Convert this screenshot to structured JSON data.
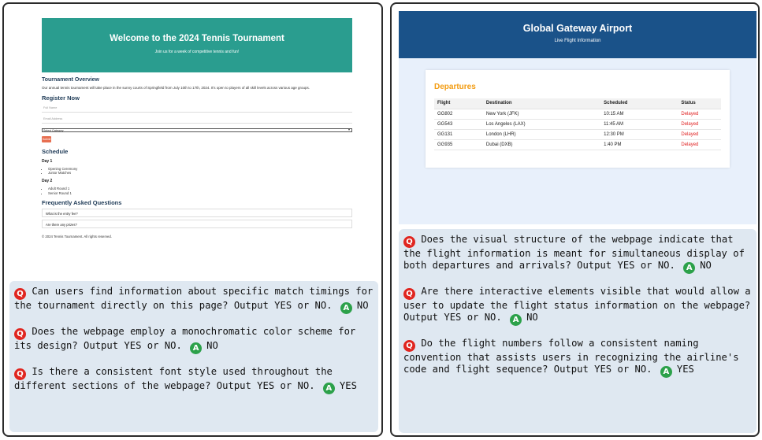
{
  "left": {
    "hero": {
      "title": "Welcome to the 2024 Tennis Tournament",
      "subtitle": "Join us for a week of competitive tennis and fun!"
    },
    "overview": {
      "heading": "Tournament Overview",
      "text": "Our annual tennis tournament will take place in the sunny courts of Springfield from July 10th to 17th, 2024. It's open to players of all skill levels across various age groups."
    },
    "register": {
      "heading": "Register Now",
      "name_placeholder": "Full Name",
      "email_placeholder": "Email Address",
      "category_selected": "Select Category",
      "submit_label": "Submit"
    },
    "schedule": {
      "heading": "Schedule",
      "days": [
        {
          "label": "Day 1",
          "items": [
            "Opening Ceremony",
            "Junior Matches"
          ]
        },
        {
          "label": "Day 2",
          "items": [
            "Adult Round 1",
            "Senior Round 1"
          ]
        }
      ]
    },
    "faq": {
      "heading": "Frequently Asked Questions",
      "items": [
        "What is the entry fee?",
        "Are there any prizes?"
      ]
    },
    "footer": "© 2024 Tennis Tournament. All rights reserved.",
    "qa": [
      {
        "q": "Can users find information about specific match timings for the tournament directly on this page? Output YES or NO.",
        "a": "NO"
      },
      {
        "q": "Does the webpage employ a monochromatic color scheme for its design? Output YES or NO.",
        "a": "NO"
      },
      {
        "q": "Is there a consistent font style used throughout the different sections of the webpage? Output YES or NO.",
        "a": "YES"
      }
    ]
  },
  "right": {
    "header": {
      "title": "Global Gateway Airport",
      "subtitle": "Live Flight Information"
    },
    "departures": {
      "heading": "Departures",
      "columns": [
        "Flight",
        "Destination",
        "Scheduled",
        "Status"
      ],
      "rows": [
        [
          "GG802",
          "New York (JFK)",
          "10:15 AM",
          "Delayed"
        ],
        [
          "GG543",
          "Los Angeles (LAX)",
          "11:45 AM",
          "Delayed"
        ],
        [
          "GG131",
          "London (LHR)",
          "12:30 PM",
          "Delayed"
        ],
        [
          "GG935",
          "Dubai (DXB)",
          "1:40 PM",
          "Delayed"
        ]
      ]
    },
    "qa": [
      {
        "q": "Does the visual structure of the webpage indicate that the flight information is meant for simultaneous display of both departures and arrivals? Output YES or NO.",
        "a": "NO"
      },
      {
        "q": "Are there interactive elements visible that would allow a user to update the flight status information on the webpage? Output YES or NO.",
        "a": "NO"
      },
      {
        "q": "Do the flight numbers follow a consistent naming convention that assists users in recognizing the airline's code and flight sequence? Output YES or NO.",
        "a": "YES"
      }
    ]
  },
  "badges": {
    "question": "Q",
    "answer": "A"
  },
  "colors": {
    "tennis_hero": "#2a9d8f",
    "tennis_submit": "#e76f51",
    "airport_header": "#1a5289",
    "departures_heading": "#f39c12",
    "status_delayed": "#e02020",
    "qa_background": "#dfe8f1",
    "question_badge": "#e0251f",
    "answer_badge": "#2ca14a"
  }
}
